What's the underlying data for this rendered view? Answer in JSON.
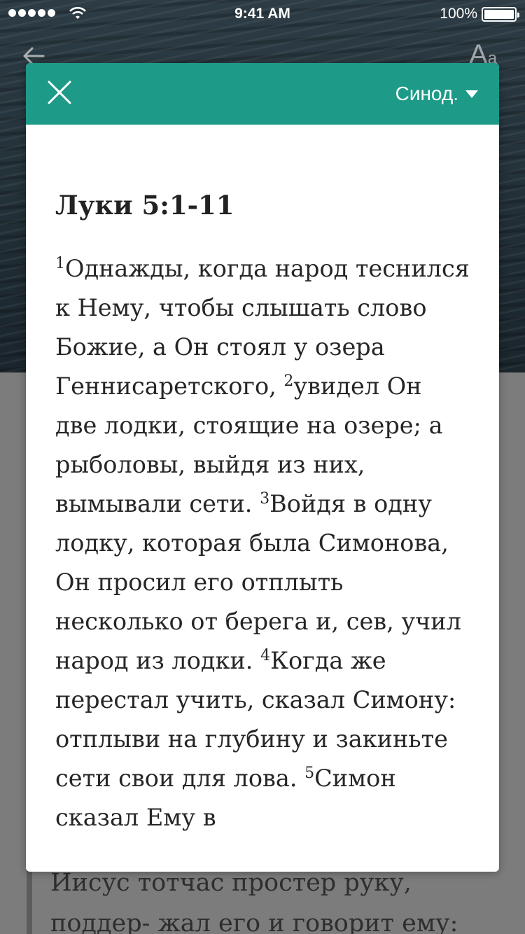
{
  "status_bar": {
    "time": "9:41 AM",
    "battery": "100%"
  },
  "nav": {
    "back_icon": "arrow-left-icon",
    "font_size_label": "A",
    "font_size_small": "a"
  },
  "modal": {
    "version": "Синод.",
    "passage_title": "Луки 5:1-11",
    "verses": [
      {
        "num": "1",
        "text": "Однажды, когда народ теснился к Нему, чтобы слышать слово Божие, а Он стоял у озера Геннисаретского, "
      },
      {
        "num": "2",
        "text": "увидел Он две лодки, стоящие на озере; а рыболовы, выйдя из них, вымывали сети. "
      },
      {
        "num": "3",
        "text": "Войдя в одну лодку, которая была Симонова, Он просил его отплыть несколько от берега и, сев, учил народ из лодки. "
      },
      {
        "num": "4",
        "text": "Когда же перестал учить, сказал Симону: отплыви на глубину и закиньте сети свои для лова. "
      },
      {
        "num": "5",
        "text": "Симон сказал Ему в"
      }
    ]
  },
  "background": {
    "text_line_1": "Иисус тотчас простер руку,",
    "text_line_2": "поддер- жал его и говорит ему:"
  }
}
